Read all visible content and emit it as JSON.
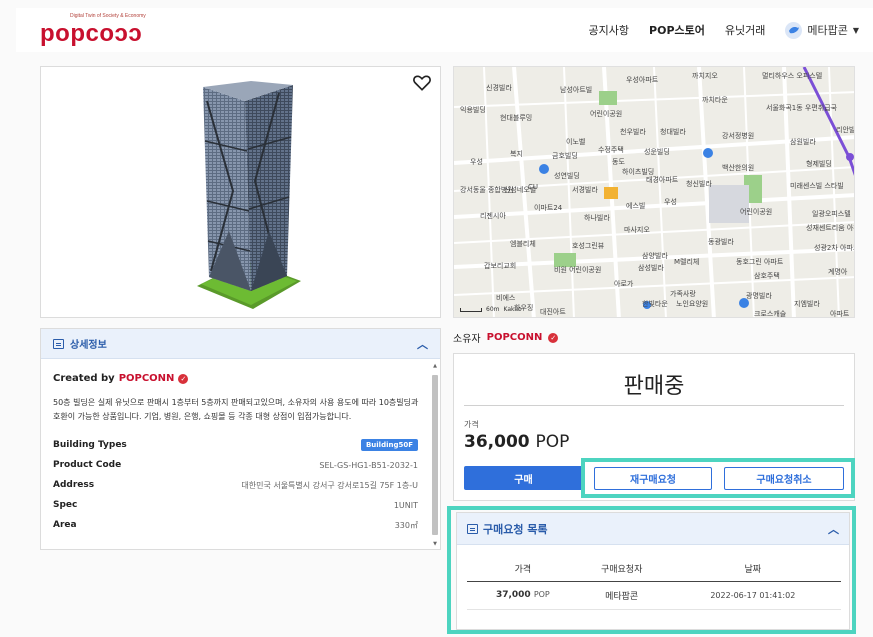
{
  "header": {
    "logo_tagline": "Digital Twin of Society & Economy",
    "logo_text": "popcoᴐᴐ",
    "nav": [
      "공지사항",
      "POP스토어",
      "유닛거래"
    ],
    "user_name": "메타팝콘"
  },
  "map": {
    "labels": [
      "신경빌라",
      "남성아트빌",
      "우성아파트",
      "까치지오",
      "멀티하우스 오피스텔",
      "익용빌딩",
      "현대블루밍",
      "어린이공원",
      "까치타운",
      "서울화곡1동 우편취급국",
      "이노벨",
      "천우빌라",
      "청대빌라",
      "강서정병원",
      "삼원빌라",
      "수정주택",
      "복지",
      "금호빌딩",
      "성운빌딩",
      "리안빌",
      "우성",
      "동도",
      "하이츠빌딩",
      "백산한의원",
      "형제빌딩",
      "성연빌딩",
      "태경아파트",
      "CU",
      "강서동울 종합병원",
      "신성네오빌",
      "서경빌라",
      "청신빌라",
      "미래센스빌 스타빌",
      "이마트24",
      "에스빌",
      "우성",
      "어린이공원",
      "일광오피스텔",
      "리젠시아",
      "하나빌라",
      "마사지오",
      "성재센트리움 아파트",
      "엠블리체",
      "호성그린뷰",
      "동광빌라",
      "삼양빌라",
      "성광2차 아파트",
      "갑보리교회",
      "비원 어린이공원",
      "삼성빌라",
      "M렐리체",
      "동호그린 아파트",
      "계명아",
      "아로가",
      "삼호주택",
      "비에스",
      "가족사랑",
      "광명빌라",
      "하우징",
      "한빛타운",
      "노인요양원",
      "지엠빌라",
      "대진아트",
      "크로스캐슬",
      "아파트"
    ],
    "scale": "60m",
    "brand": "Kakao"
  },
  "detail": {
    "title": "상세정보",
    "created_by_label": "Created by",
    "creator": "POPCONN",
    "description": "50층 빌딩은 실제 유닛으로 판매시 1층부터 5층까지 판매되고있으며, 소유자의 사용 용도에 따라 10층빌딩과 호환이 가능한 상품입니다. 기업, 병원, 은행, 쇼핑몰 등 각종 대형 상점이 입점가능합니다.",
    "specs": [
      {
        "key": "Building Types",
        "value": "Building50F"
      },
      {
        "key": "Product Code",
        "value": "SEL-GS-HG1-B51-2032-1"
      },
      {
        "key": "Address",
        "value": "대한민국 서울특별시 강서구 강서로15길 75F 1층-U"
      },
      {
        "key": "Spec",
        "value": "1UNIT"
      },
      {
        "key": "Area",
        "value": "330㎡"
      }
    ]
  },
  "owner": {
    "label": "소유자",
    "name": "POPCONN"
  },
  "sale": {
    "status": "판매중",
    "price_label": "가격",
    "price_value": "36,000",
    "price_unit": "POP",
    "buy_button": "구매",
    "rebuy_button": "재구매요청",
    "cancel_button": "구매요청취소"
  },
  "requests": {
    "title": "구매요청 목록",
    "columns": [
      "가격",
      "구매요청자",
      "날짜"
    ],
    "rows": [
      {
        "price": "37,000",
        "unit": "POP",
        "requester": "메타팝콘",
        "date": "2022-06-17 01:41:02"
      }
    ]
  },
  "colors": {
    "brand": "#c8102e",
    "accent": "#2f6fdb",
    "highlight": "#4dd4c0"
  }
}
